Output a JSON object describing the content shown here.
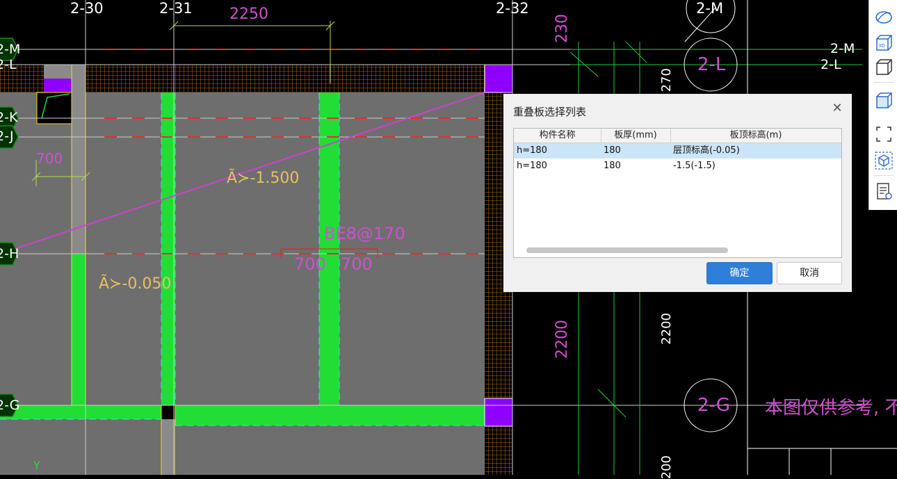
{
  "drawing": {
    "axes_top": [
      "2-30",
      "2-31",
      "2-32",
      "2-M"
    ],
    "axes_left": [
      "2-M",
      "2-L",
      "2-K",
      "2-J",
      "2-H",
      "2-G"
    ],
    "axes_right": [
      "2-M",
      "2-L"
    ],
    "bubble_2L": "2-L",
    "bubble_2G": "2-G",
    "dim_2250": "2250",
    "dim_700_left": "700",
    "dim_700_a": "700",
    "dim_700_b": "700",
    "dim_230": "230",
    "dim_2200_pink": "2200",
    "dim_2200_white": "2200",
    "dim_270": "270",
    "dim_200_bottom": "200",
    "label_slab_1500": "Ã≻-1.500",
    "label_slab_0050": "Ã≻-0.050",
    "label_rebar": "BE8@170",
    "note_text": "本图仅供参考, 不作其他",
    "axis_y": "Y",
    "colors": {
      "slab": "#6e6e6e",
      "beam": "#22dd33",
      "column": "#9000ff",
      "hatch": "#b56a12",
      "pink_text": "#d050d0",
      "yellow_text": "#e8c060"
    }
  },
  "dialog": {
    "title": "重叠板选择列表",
    "columns": [
      "构件名称",
      "板厚(mm)",
      "板顶标高(m)"
    ],
    "rows": [
      {
        "name": "h=180",
        "thickness": "180",
        "elevation": "层顶标高(-0.05)",
        "selected": true
      },
      {
        "name": "h=180",
        "thickness": "180",
        "elevation": "-1.5(-1.5)",
        "selected": false
      }
    ],
    "ok_label": "确定",
    "cancel_label": "取消"
  },
  "toolbar": {
    "items": [
      "perspective-icon",
      "3d-view-icon",
      "box-view-icon",
      "solid-box-icon",
      "select-area-icon",
      "view-cube-icon",
      "report-view-icon"
    ]
  }
}
